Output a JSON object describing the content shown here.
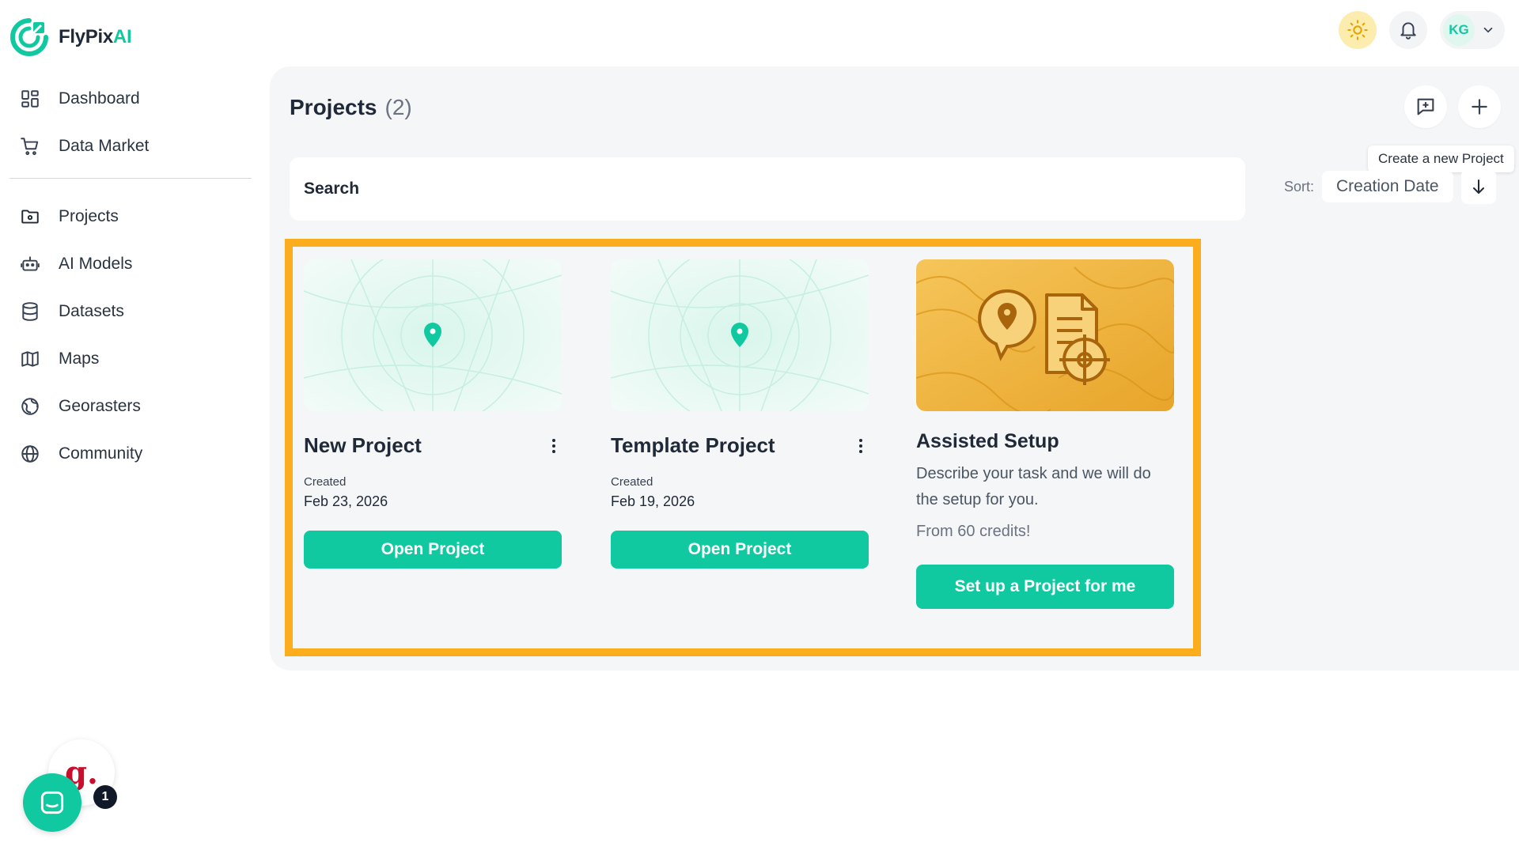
{
  "app": {
    "name_main": "FlyPix",
    "name_accent": "AI"
  },
  "sidebar": {
    "items": [
      {
        "label": "Dashboard",
        "icon": "dashboard-icon"
      },
      {
        "label": "Data Market",
        "icon": "cart-icon"
      },
      {
        "label": "Projects",
        "icon": "folder-icon"
      },
      {
        "label": "AI Models",
        "icon": "robot-icon"
      },
      {
        "label": "Datasets",
        "icon": "database-icon"
      },
      {
        "label": "Maps",
        "icon": "map-icon"
      },
      {
        "label": "Georasters",
        "icon": "globe-grid-icon"
      },
      {
        "label": "Community",
        "icon": "globe-icon"
      }
    ]
  },
  "header": {
    "user_initials": "KG"
  },
  "main": {
    "title": "Projects",
    "count": "(2)",
    "tooltip": "Create a new Project",
    "search_label": "Search",
    "sort_label": "Sort:",
    "sort_value": "Creation Date"
  },
  "projects": [
    {
      "name": "New Project",
      "created_label": "Created",
      "created": "Feb 23, 2026",
      "button": "Open Project"
    },
    {
      "name": "Template Project",
      "created_label": "Created",
      "created": "Feb 19, 2026",
      "button": "Open Project"
    }
  ],
  "assisted": {
    "title": "Assisted Setup",
    "description": "Describe your task and we will do the setup for you.",
    "credits": "From 60 credits!",
    "button": "Set up a Project for me"
  },
  "widgets": {
    "g_letter": "g.",
    "chat_badge": "1"
  },
  "colors": {
    "accent": "#10c9a0",
    "highlight": "#fbad1d",
    "panel": "#f5f6f8"
  }
}
